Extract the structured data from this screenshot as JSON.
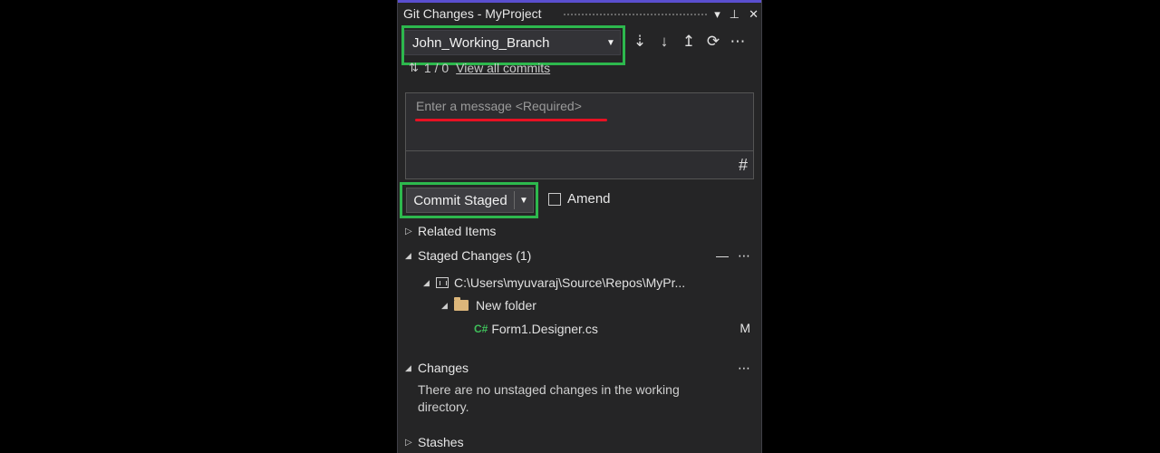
{
  "window": {
    "title": "Git Changes - MyProject"
  },
  "branch": {
    "name": "John_Working_Branch"
  },
  "commits": {
    "count": "1 / 0",
    "link_label": "View all commits"
  },
  "message": {
    "placeholder": "Enter a message <Required>"
  },
  "commit": {
    "button_label": "Commit Staged",
    "amend_label": "Amend",
    "amend_checked": false
  },
  "sections": {
    "related_items": "Related Items",
    "staged_changes": "Staged Changes (1)",
    "changes": "Changes",
    "stashes": "Stashes"
  },
  "staged_tree": {
    "repo_path": "C:\\Users\\myuvaraj\\Source\\Repos\\MyPr...",
    "folder": "New folder",
    "file": {
      "icon_text": "C#",
      "name": "Form1.Designer.cs",
      "status": "M"
    }
  },
  "changes_message": "There are no unstaged changes in the working directory.",
  "colors": {
    "highlight_box": "#2db84d",
    "underline": "#e81123",
    "panel_bg": "#252526",
    "accent": "#5a4fcf"
  }
}
